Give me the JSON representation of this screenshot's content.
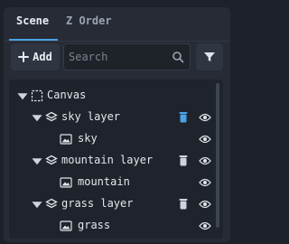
{
  "tabs": [
    {
      "label": "Scene",
      "active": true
    },
    {
      "label": "Z Order",
      "active": false
    }
  ],
  "toolbar": {
    "add_label": "Add",
    "search_placeholder": "Search",
    "search_value": ""
  },
  "tree": [
    {
      "label": "Canvas",
      "type": "canvas",
      "expanded": true,
      "visible": true
    },
    {
      "label": "sky layer",
      "type": "layer",
      "expanded": true,
      "visible": true,
      "locked_icon_highlight": true
    },
    {
      "label": "sky",
      "type": "image",
      "visible": true
    },
    {
      "label": "mountain layer",
      "type": "layer",
      "expanded": true,
      "visible": true
    },
    {
      "label": "mountain",
      "type": "image",
      "visible": true
    },
    {
      "label": "grass layer",
      "type": "layer",
      "expanded": true,
      "visible": true
    },
    {
      "label": "grass",
      "type": "image",
      "visible": true
    }
  ],
  "colors": {
    "accent": "#4aa3e8",
    "panel": "#262b35",
    "tree_bg": "#1f232b"
  }
}
